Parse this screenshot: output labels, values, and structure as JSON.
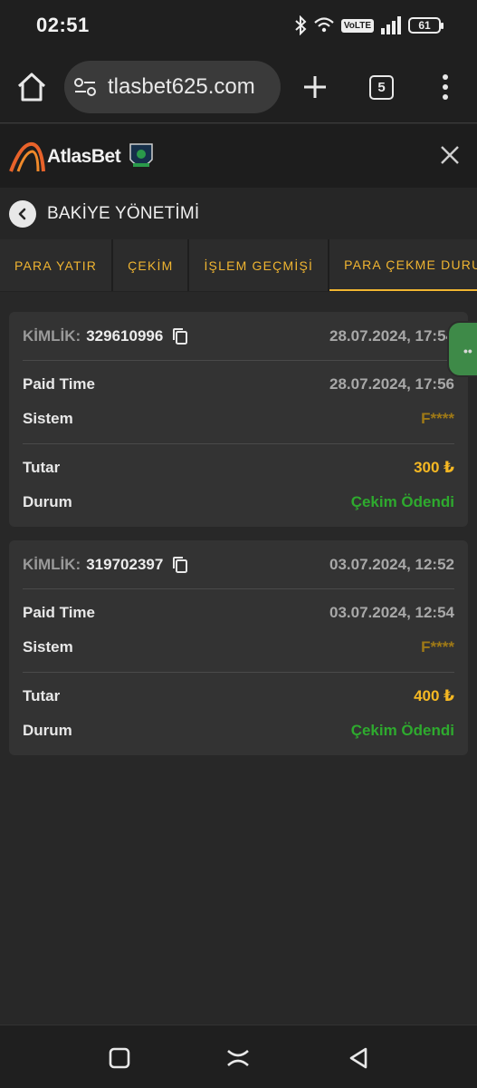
{
  "status": {
    "time": "02:51",
    "volte": "VoLTE",
    "battery": "61"
  },
  "browser": {
    "url": "tlasbet625.com",
    "tab_count": "5"
  },
  "site": {
    "logo_text": "AtlasBet"
  },
  "section": {
    "title": "BAKİYE YÖNETİMİ"
  },
  "tabs": [
    {
      "label": "PARA YATIR"
    },
    {
      "label": "ÇEKİM"
    },
    {
      "label": "İŞLEM GEÇMİŞİ"
    },
    {
      "label": "PARA ÇEKME DURUMU"
    }
  ],
  "transactions": [
    {
      "kimlik_label": "KİMLİK:",
      "kimlik": "329610996",
      "created": "28.07.2024, 17:54",
      "paid_time_label": "Paid Time",
      "paid_time": "28.07.2024, 17:56",
      "sistem_label": "Sistem",
      "sistem": "F****",
      "tutar_label": "Tutar",
      "tutar": "300 ₺",
      "durum_label": "Durum",
      "durum": "Çekim Ödendi"
    },
    {
      "kimlik_label": "KİMLİK:",
      "kimlik": "319702397",
      "created": "03.07.2024, 12:52",
      "paid_time_label": "Paid Time",
      "paid_time": "03.07.2024, 12:54",
      "sistem_label": "Sistem",
      "sistem": "F****",
      "tutar_label": "Tutar",
      "tutar": "400 ₺",
      "durum_label": "Durum",
      "durum": "Çekim Ödendi"
    }
  ],
  "colors": {
    "accent": "#f0b531",
    "success": "#2eaa2e",
    "background": "#282828",
    "card": "#333333"
  }
}
